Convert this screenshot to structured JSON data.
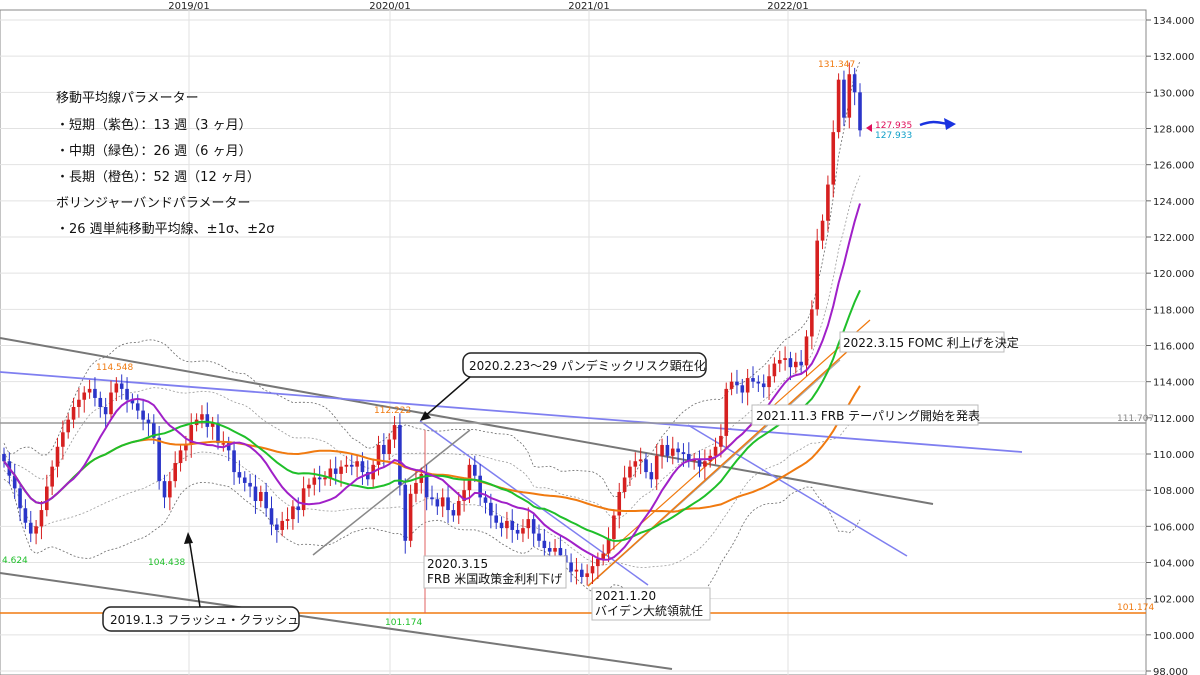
{
  "chart_data": {
    "type": "candlestick",
    "instrument_note": "",
    "x_ticks": [
      "2019/01",
      "2020/01",
      "2021/01",
      "2022/01"
    ],
    "y_ticks": [
      "98.000",
      "100.000",
      "102.000",
      "104.000",
      "106.000",
      "108.000",
      "110.000",
      "112.000",
      "114.000",
      "116.000",
      "118.000",
      "120.000",
      "122.000",
      "124.000",
      "126.000",
      "128.000",
      "130.000",
      "132.000",
      "134.000"
    ],
    "ylim": [
      98,
      134
    ],
    "grid": true,
    "parameters": {
      "title": "移動平均線パラメーター",
      "lines": [
        "・短期（紫色）：13 週（3 ヶ月）",
        "・中期（緑色）：26 週（6 ヶ月）",
        "・長期（橙色）：52 週（12 ヶ月）",
        "ボリンジャーバンドパラメーター",
        "・26 週単純移動平均線、±1σ、±2σ"
      ]
    },
    "price_labels": {
      "high_2018": "114.548",
      "low_2018": "4.624",
      "low_2019": "104.438",
      "high_2020": "112.222",
      "low_2020": "101.174",
      "high_2022": "131.347",
      "last_close_a": "127.935",
      "last_close_b": "127.933",
      "ref_line_112": "111.707",
      "ref_line_101": "101.174"
    },
    "annotations": {
      "pandemic": "2020.2.23～29 パンデミックリスク顕在化",
      "flash_crash": "2019.1.3 フラッシュ・クラッシュ",
      "frb_cut_date": "2020.3.15",
      "frb_cut_text": "FRB 米国政策金利利下げ",
      "biden_date": "2021.1.20",
      "biden_text": "バイデン大統領就任",
      "tapering": "2021.11.3 FRB テーパリング開始を発表",
      "fomc_hike": "2022.3.15 FOMC 利上げを決定"
    },
    "colors": {
      "up": "#d62020",
      "down": "#2b35c8",
      "ma13": "#a020c8",
      "ma26": "#1fbf2a",
      "ma52": "#f07a10",
      "trend_blue": "#7f7ff0",
      "trend_gray": "#666666",
      "arrow": "#1a33e0"
    },
    "weekly_close_series": [
      109.6,
      108.8,
      108.1,
      107.0,
      106.2,
      105.6,
      106.0,
      106.9,
      108.2,
      109.3,
      110.4,
      111.2,
      111.9,
      112.6,
      113.0,
      113.4,
      113.6,
      113.1,
      112.6,
      112.2,
      113.4,
      113.9,
      113.6,
      113.0,
      112.8,
      112.4,
      111.9,
      111.7,
      110.9,
      108.5,
      107.6,
      108.5,
      109.5,
      110.2,
      110.5,
      111.6,
      111.9,
      112.2,
      111.5,
      111.7,
      110.6,
      110.6,
      110.2,
      109.0,
      108.7,
      108.4,
      108.2,
      107.4,
      107.9,
      107.0,
      106.1,
      105.8,
      106.3,
      106.4,
      107.1,
      106.9,
      108.1,
      108.3,
      108.7,
      108.6,
      108.7,
      109.2,
      108.9,
      109.3,
      109.4,
      109.3,
      109.6,
      109.0,
      108.6,
      109.4,
      110.5,
      110.0,
      110.8,
      111.6,
      108.3,
      105.2,
      107.8,
      108.4,
      108.9,
      107.6,
      107.5,
      107.1,
      107.6,
      106.9,
      106.6,
      107.4,
      108.0,
      109.4,
      108.8,
      107.6,
      107.3,
      106.6,
      106.2,
      105.9,
      106.3,
      105.8,
      105.6,
      105.9,
      106.4,
      105.6,
      105.2,
      104.8,
      104.6,
      104.8,
      104.4,
      104.0,
      103.5,
      103.6,
      103.2,
      103.4,
      103.8,
      104.2,
      104.5,
      105.3,
      106.6,
      107.9,
      108.7,
      109.3,
      109.6,
      109.7,
      109.0,
      108.6,
      109.9,
      110.5,
      109.9,
      110.3,
      110.1,
      110.0,
      109.6,
      109.7,
      109.3,
      109.6,
      109.9,
      110.4,
      111.0,
      113.6,
      114.0,
      113.8,
      113.4,
      114.2,
      114.0,
      113.9,
      113.7,
      114.3,
      115.0,
      115.2,
      115.3,
      114.8,
      115.1,
      114.9,
      116.5,
      118.0,
      121.8,
      122.9,
      124.9,
      127.8,
      130.7,
      128.6,
      131.0,
      130.0,
      127.9
    ]
  }
}
